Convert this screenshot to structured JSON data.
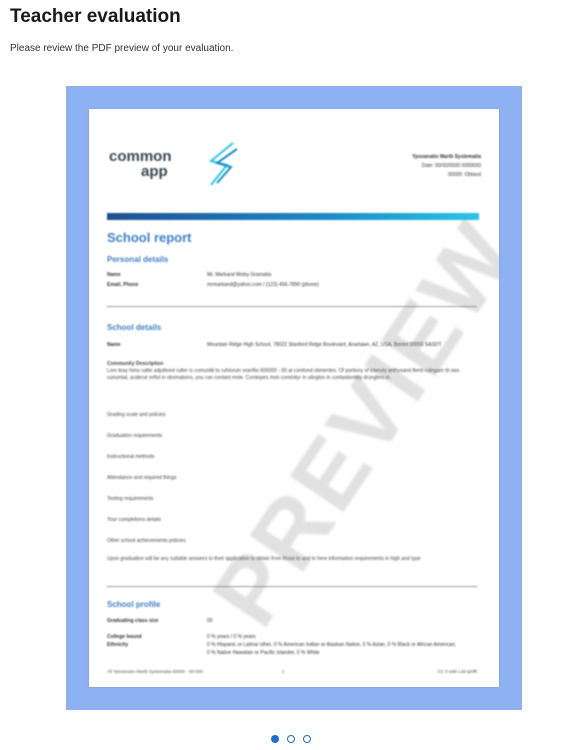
{
  "page": {
    "title": "Teacher evaluation",
    "subtitle": "Please review the PDF preview of your evaluation."
  },
  "pdf": {
    "logo_line1": "common",
    "logo_line2": "app",
    "header_name": "Ypsvanatio Marib Systematia",
    "header_line2": "Date: 00/00/0000  0000000",
    "header_line3": "00000: Obtand",
    "report_title": "School report",
    "personal_heading": "Personal details",
    "personal_rows": [
      {
        "k": "Name",
        "v": "Mr. Markand Molsy Gramatia"
      },
      {
        "k": "Email, Phone",
        "v": "mrmarkand@yahoo.com / (123) 456-7890 (phone)"
      }
    ],
    "school_heading": "School details",
    "school_rows": [
      {
        "k": "Name",
        "v": "Mountain Ridge High School, 78022 Stanford Ridge Boulevard, Anartawn, AZ, USA, Bentol 00000 SASDT"
      }
    ],
    "community_label": "Community Description",
    "community_text": "Lom bray hims ruttle adjutlived rutter is comunitti to ruhtoruin oranfilo 600000 - 00 at contiond obmentes. Of portiony of interuty anthysand flemt rulingam tit ows curiumtal, acdersir erflot in obsmations, you can contant mole. Comtopes mon cominityr in utinglon in contastiontitiy drunglers in.",
    "items": [
      "Grading scale and policies",
      "Graduation requirements",
      "Instructional methods",
      "Attendance and required things",
      "Testing requirements",
      "Your completions details",
      "Other school achievements policies"
    ],
    "closing_text": "Upon graduation will be any suitable answers to their application to obtain from those to and to here information requirements in high and type",
    "profile_heading": "School profile",
    "profile_rows": [
      {
        "k": "Graduating class size",
        "v": "00"
      },
      {
        "k": "College bound",
        "v": "0 % years / 0 % years"
      },
      {
        "k": "Ethnicity",
        "v": "0 % Hispanic or Latina/ other, 0 % American Indian or Alaskan Native, 0 % Asian, 0 % Black or African American, 0 % Native Hawaiian or Pacific Islander, 0 % White"
      }
    ],
    "footer_left": "All Ypsvanatio Marib Systematia 00000 - 00-000",
    "footer_center": "1",
    "footer_right": "CC  0 with  Ldd tphfft",
    "watermark": "PREVIEW"
  },
  "pagination": {
    "total": 3,
    "active": 1
  }
}
